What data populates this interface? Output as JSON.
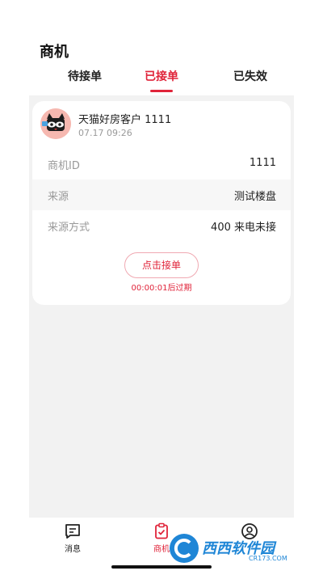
{
  "header": {
    "title": "商机"
  },
  "tabs": [
    {
      "label": "待接单"
    },
    {
      "label": "已接单"
    },
    {
      "label": "已失效"
    }
  ],
  "active_tab": "已接单",
  "card": {
    "customer_name": "天猫好房客户 1111",
    "time": "07.17 09:26",
    "rows": [
      {
        "label": "商机ID",
        "value": "1111"
      },
      {
        "label": "来源",
        "value": "测试楼盘"
      },
      {
        "label": "来源方式",
        "value": "400 来电未接"
      }
    ],
    "accept_label": "点击接单",
    "expire_text": "00:00:01后过期"
  },
  "bottom_nav": [
    {
      "label": "消息",
      "icon": "message-icon"
    },
    {
      "label": "商机",
      "icon": "clipboard-check-icon"
    },
    {
      "label": "",
      "icon": "user-circle-icon"
    }
  ],
  "watermark": {
    "text": "西西软件园",
    "sub": "CR173.COM"
  },
  "colors": {
    "accent": "#e0243a",
    "background": "#f2f2f2",
    "watermark": "#1f86d6"
  }
}
